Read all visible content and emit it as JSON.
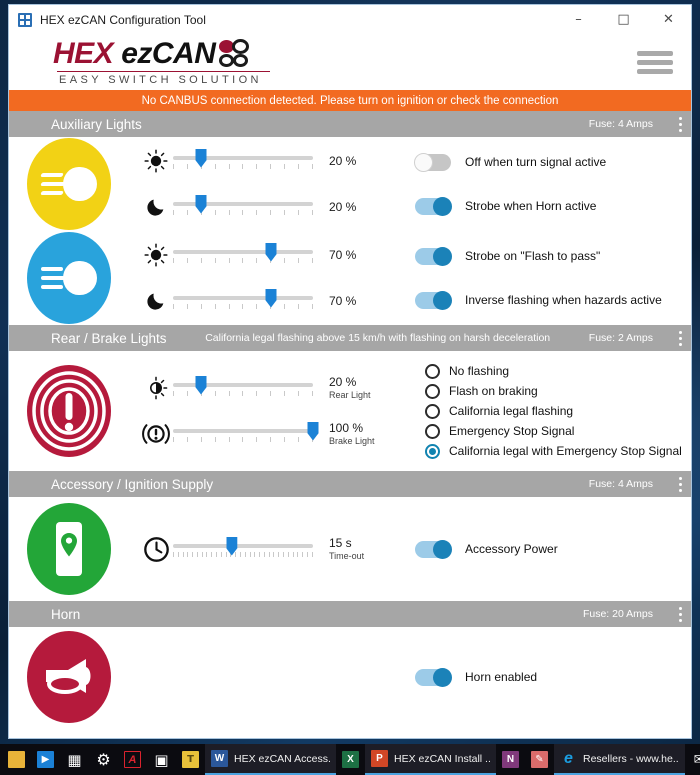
{
  "window": {
    "title": "HEX ezCAN Configuration Tool",
    "minimize": "–",
    "maximize": "□",
    "close": "✕"
  },
  "logo": {
    "hex": "HEX",
    "ez": "ezCAN",
    "tagline": "EASY SWITCH SOLUTION"
  },
  "alert": {
    "message": "No CANBUS connection detected. Please turn on ignition or check the connection",
    "color": "#f26a21"
  },
  "sections": [
    {
      "id": "auxiliary-lights",
      "title": "Auxiliary Lights",
      "note": "",
      "fuse": "Fuse: 4 Amps",
      "rows": [
        {
          "icon_color": "#f2d215",
          "icon_name": "high-beam-lamp-icon",
          "sliders": [
            {
              "icon": "sun-icon",
              "value": 20,
              "label": "20 %",
              "sub": ""
            },
            {
              "icon": "moon-icon",
              "value": 20,
              "label": "20 %",
              "sub": ""
            }
          ],
          "toggles": [
            {
              "label": "Off when turn signal active",
              "state": "off"
            },
            {
              "label": "Strobe when Horn active",
              "state": "on"
            }
          ]
        },
        {
          "icon_color": "#29a3dc",
          "icon_name": "low-beam-lamp-icon",
          "sliders": [
            {
              "icon": "sun-icon",
              "value": 70,
              "label": "70 %",
              "sub": ""
            },
            {
              "icon": "moon-icon",
              "value": 70,
              "label": "70 %",
              "sub": ""
            }
          ],
          "toggles": [
            {
              "label": "Strobe on \"Flash to pass\"",
              "state": "on"
            },
            {
              "label": "Inverse flashing when hazards active",
              "state": "on"
            }
          ]
        }
      ]
    },
    {
      "id": "rear-brake-lights",
      "title": "Rear / Brake Lights",
      "note": "California legal flashing above 15 km/h with flashing on harsh deceleration",
      "fuse": "Fuse: 2 Amps",
      "sliders": [
        {
          "icon": "half-sun-icon",
          "value": 20,
          "label": "20 %",
          "sub": "Rear Light"
        },
        {
          "icon": "brake-warn-icon",
          "value": 100,
          "label": "100 %",
          "sub": "Brake Light"
        }
      ],
      "radios": [
        {
          "label": "No flashing",
          "checked": false
        },
        {
          "label": "Flash on braking",
          "checked": false
        },
        {
          "label": "California legal flashing",
          "checked": false
        },
        {
          "label": "Emergency Stop Signal",
          "checked": false
        },
        {
          "label": "California legal with Emergency Stop Signal",
          "checked": true
        }
      ]
    },
    {
      "id": "accessory-ignition-supply",
      "title": "Accessory / Ignition Supply",
      "note": "",
      "fuse": "Fuse: 4 Amps",
      "sliders": [
        {
          "icon": "clock-icon",
          "value": 42,
          "label": "15 s",
          "sub": "Time-out"
        }
      ],
      "toggles": [
        {
          "label": "Accessory Power",
          "state": "on"
        }
      ]
    },
    {
      "id": "horn",
      "title": "Horn",
      "note": "",
      "fuse": "Fuse: 20 Amps",
      "toggles": [
        {
          "label": "Horn enabled",
          "state": "on"
        }
      ]
    }
  ],
  "taskbar": {
    "items": [
      {
        "name": "explorer-icon",
        "glyph": "⬛",
        "short": "",
        "label": "",
        "color": "#e8b339",
        "active": false
      },
      {
        "name": "media-player-icon",
        "glyph": "▶",
        "short": "",
        "label": "",
        "color": "#1b81d6",
        "active": false
      },
      {
        "name": "microsoft-store-icon",
        "glyph": "▤",
        "short": "",
        "label": "",
        "color": "#ffffff",
        "active": false
      },
      {
        "name": "settings-gear-icon",
        "glyph": "⚙",
        "short": "",
        "label": "",
        "color": "#ffffff",
        "active": false
      },
      {
        "name": "adobe-acrobat-icon",
        "glyph": "A",
        "short": "",
        "label": "",
        "color": "#d9232e",
        "active": false
      },
      {
        "name": "calculator-icon",
        "glyph": "⌸",
        "short": "",
        "label": "",
        "color": "#ffffff",
        "active": false
      },
      {
        "name": "sticky-notes-icon",
        "glyph": "◧",
        "short": "",
        "label": "",
        "color": "#e8c13a",
        "active": false
      },
      {
        "name": "word-document-icon",
        "glyph": "",
        "short": "W",
        "label": "HEX ezCAN Access...",
        "color": "#2b579a",
        "active": true
      },
      {
        "name": "excel-icon",
        "glyph": "",
        "short": "X",
        "label": "",
        "color": "#1d7044",
        "active": false
      },
      {
        "name": "powerpoint-icon",
        "glyph": "",
        "short": "P",
        "label": "HEX ezCAN Install ...",
        "color": "#d24726",
        "active": true
      },
      {
        "name": "onenote-icon",
        "glyph": "",
        "short": "N",
        "label": "",
        "color": "#80397b",
        "active": false
      },
      {
        "name": "publisher-icon",
        "glyph": "✐",
        "short": "",
        "label": "",
        "color": "#d96b6b",
        "active": false
      },
      {
        "name": "edge-browser-icon",
        "glyph": "e",
        "short": "",
        "label": "Resellers - www.he...",
        "color": "#1b81d6",
        "active": true
      },
      {
        "name": "mail-icon",
        "glyph": "✉",
        "short": "",
        "label": "",
        "color": "#ffffff",
        "active": false
      }
    ]
  }
}
